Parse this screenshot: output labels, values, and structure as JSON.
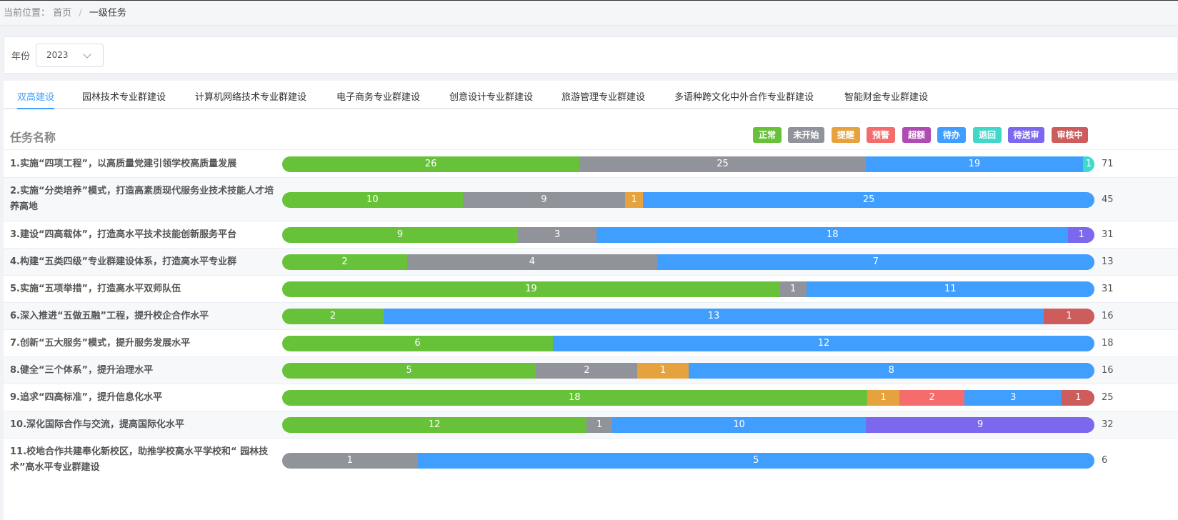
{
  "breadcrumb": {
    "prefix": "当前位置：",
    "home": "首页",
    "separator": "/",
    "current": "一级任务"
  },
  "filter": {
    "label": "年份",
    "year": "2023"
  },
  "tabs": [
    {
      "label": "双高建设",
      "active": true
    },
    {
      "label": "园林技术专业群建设",
      "active": false
    },
    {
      "label": "计算机网络技术专业群建设",
      "active": false
    },
    {
      "label": "电子商务专业群建设",
      "active": false
    },
    {
      "label": "创意设计专业群建设",
      "active": false
    },
    {
      "label": "旅游管理专业群建设",
      "active": false
    },
    {
      "label": "多语种跨文化中外合作专业群建设",
      "active": false
    },
    {
      "label": "智能财金专业群建设",
      "active": false
    }
  ],
  "table": {
    "header": "任务名称"
  },
  "legend": [
    {
      "key": "normal",
      "label": "正常",
      "color": "#67c23a"
    },
    {
      "key": "not_started",
      "label": "未开始",
      "color": "#909399"
    },
    {
      "key": "remind",
      "label": "提醒",
      "color": "#e6a23c"
    },
    {
      "key": "warning",
      "label": "预警",
      "color": "#f56c6c"
    },
    {
      "key": "overdue",
      "label": "超额",
      "color": "#b04bb3"
    },
    {
      "key": "todo",
      "label": "待办",
      "color": "#409eff"
    },
    {
      "key": "returned",
      "label": "退回",
      "color": "#40d9c9"
    },
    {
      "key": "pending_send",
      "label": "待送审",
      "color": "#7b68ee"
    },
    {
      "key": "reviewing",
      "label": "审核中",
      "color": "#cd5c5c"
    }
  ],
  "tasks": [
    {
      "name": "1.实施“四项工程”，以高质量党建引领学校高质量发展",
      "total": "71",
      "segments": [
        {
          "status": "normal",
          "value": 26
        },
        {
          "status": "not_started",
          "value": 25
        },
        {
          "status": "todo",
          "value": 19
        },
        {
          "status": "returned",
          "value": 1
        }
      ]
    },
    {
      "name": "2.实施“分类培养”模式，打造高素质现代服务业技术技能人才培养高地",
      "total": "45",
      "segments": [
        {
          "status": "normal",
          "value": 10
        },
        {
          "status": "not_started",
          "value": 9
        },
        {
          "status": "remind",
          "value": 1
        },
        {
          "status": "todo",
          "value": 25
        }
      ]
    },
    {
      "name": "3.建设“四高载体”，打造高水平技术技能创新服务平台",
      "total": "31",
      "segments": [
        {
          "status": "normal",
          "value": 9
        },
        {
          "status": "not_started",
          "value": 3
        },
        {
          "status": "todo",
          "value": 18
        },
        {
          "status": "pending_send",
          "value": 1
        }
      ]
    },
    {
      "name": "4.构建“五类四级”专业群建设体系，打造高水平专业群",
      "total": "13",
      "segments": [
        {
          "status": "normal",
          "value": 2
        },
        {
          "status": "not_started",
          "value": 4
        },
        {
          "status": "todo",
          "value": 7
        }
      ]
    },
    {
      "name": "5.实施“五项举措”，打造高水平双师队伍",
      "total": "31",
      "segments": [
        {
          "status": "normal",
          "value": 19
        },
        {
          "status": "not_started",
          "value": 1
        },
        {
          "status": "todo",
          "value": 11
        }
      ]
    },
    {
      "name": "6.深入推进“五做五融”工程，提升校企合作水平",
      "total": "16",
      "segments": [
        {
          "status": "normal",
          "value": 2
        },
        {
          "status": "todo",
          "value": 13
        },
        {
          "status": "reviewing",
          "value": 1
        }
      ]
    },
    {
      "name": "7.创新“五大服务”模式，提升服务发展水平",
      "total": "18",
      "segments": [
        {
          "status": "normal",
          "value": 6
        },
        {
          "status": "todo",
          "value": 12
        }
      ]
    },
    {
      "name": "8.健全“三个体系”，提升治理水平",
      "total": "16",
      "segments": [
        {
          "status": "normal",
          "value": 5
        },
        {
          "status": "not_started",
          "value": 2
        },
        {
          "status": "remind",
          "value": 1
        },
        {
          "status": "todo",
          "value": 8
        }
      ]
    },
    {
      "name": "9.追求“四高标准”，提升信息化水平",
      "total": "25",
      "segments": [
        {
          "status": "normal",
          "value": 18
        },
        {
          "status": "remind",
          "value": 1
        },
        {
          "status": "warning",
          "value": 2
        },
        {
          "status": "todo",
          "value": 3
        },
        {
          "status": "reviewing",
          "value": 1
        }
      ]
    },
    {
      "name": "10.深化国际合作与交流，提高国际化水平",
      "total": "32",
      "segments": [
        {
          "status": "normal",
          "value": 12
        },
        {
          "status": "not_started",
          "value": 1
        },
        {
          "status": "todo",
          "value": 10
        },
        {
          "status": "pending_send",
          "value": 9
        }
      ]
    },
    {
      "name": "11.校地合作共建奉化新校区，助推学校高水平学校和“ 园林技术”高水平专业群建设",
      "total": "6",
      "segments": [
        {
          "status": "not_started",
          "value": 1
        },
        {
          "status": "todo",
          "value": 5
        }
      ]
    }
  ]
}
